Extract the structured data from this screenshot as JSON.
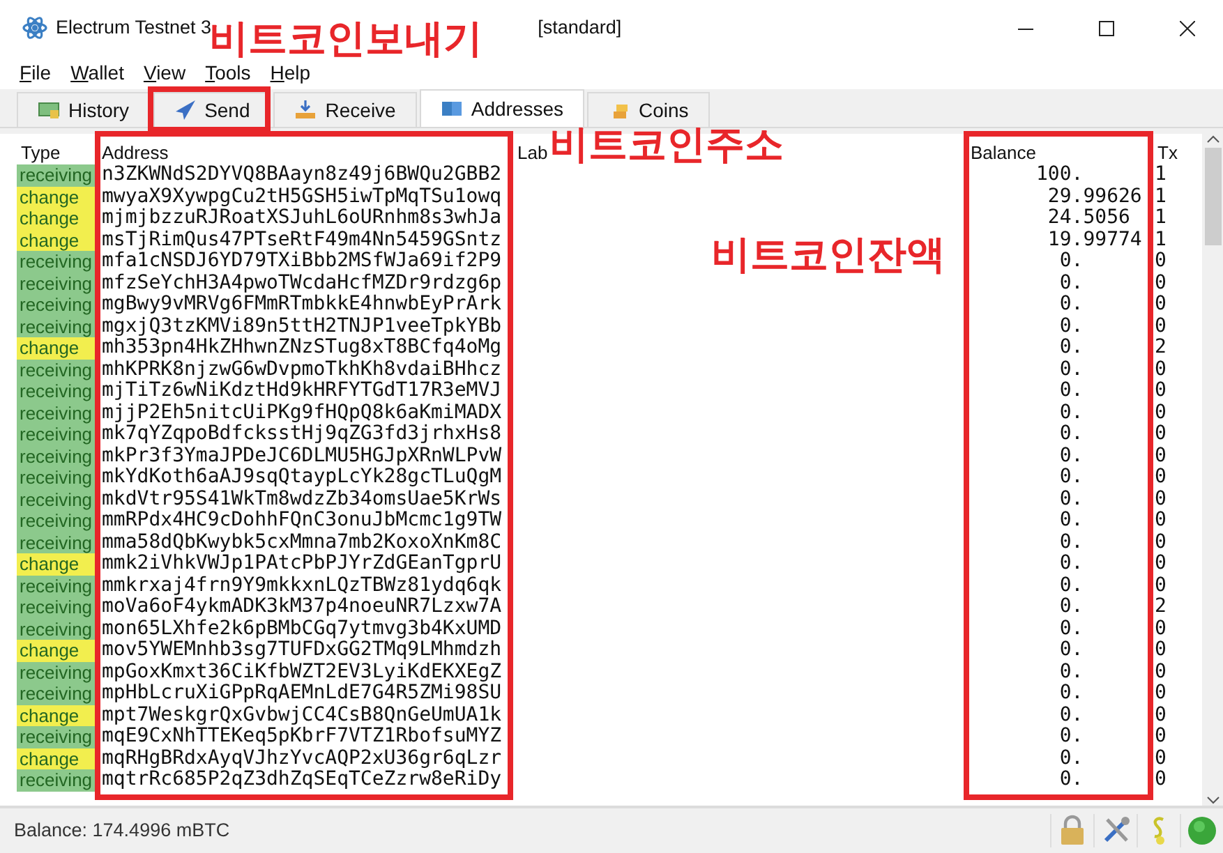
{
  "window": {
    "title": "Electrum Testnet 3",
    "title_end": "[standard]"
  },
  "menu": [
    "File",
    "Wallet",
    "View",
    "Tools",
    "Help"
  ],
  "tabs": [
    {
      "label": "History",
      "selected": false,
      "highlighted": false
    },
    {
      "label": "Send",
      "selected": false,
      "highlighted": true
    },
    {
      "label": "Receive",
      "selected": false,
      "highlighted": false
    },
    {
      "label": "Addresses",
      "selected": true,
      "highlighted": false
    },
    {
      "label": "Coins",
      "selected": false,
      "highlighted": false
    }
  ],
  "table": {
    "columns": [
      {
        "label": "Type",
        "highlighted": false
      },
      {
        "label": "Address",
        "highlighted": true
      },
      {
        "label": "Lab",
        "highlighted": false
      },
      {
        "label": "Balance",
        "highlighted": true
      },
      {
        "label": "Tx",
        "highlighted": false
      }
    ],
    "rows": [
      {
        "type": "receiving",
        "color": "#8cc98c",
        "address": "n3ZKWNdS2DYVQ8BAayn8z49j6BWQu2GBB2",
        "balance": "100.",
        "tx": "1"
      },
      {
        "type": "change",
        "color": "#f2ee4e",
        "address": "mwyaX9XywpgCu2tH5GSH5iwTpMqTSu1owq",
        "balance": "29.99626",
        "tx": "1"
      },
      {
        "type": "change",
        "color": "#f2ee4e",
        "address": "mjmjbzzuRJRoatXSJuhL6oURnhm8s3whJa",
        "balance": "24.5056",
        "tx": "1"
      },
      {
        "type": "change",
        "color": "#f2ee4e",
        "address": "msTjRimQus47PTseRtF49m4Nn5459GSntz",
        "balance": "19.99774",
        "tx": "1"
      },
      {
        "type": "receiving",
        "color": "#8cc98c",
        "address": "mfa1cNSDJ6YD79TXiBbb2MSfWJa69if2P9",
        "balance": "0.",
        "tx": "0"
      },
      {
        "type": "receiving",
        "color": "#8cc98c",
        "address": "mfzSeYchH3A4pwoTWcdaHcfMZDr9rdzg6p",
        "balance": "0.",
        "tx": "0"
      },
      {
        "type": "receiving",
        "color": "#8cc98c",
        "address": "mgBwy9vMRVg6FMmRTmbkkE4hnwbEyPrArk",
        "balance": "0.",
        "tx": "0"
      },
      {
        "type": "receiving",
        "color": "#8cc98c",
        "address": "mgxjQ3tzKMVi89n5ttH2TNJP1veeTpkYBb",
        "balance": "0.",
        "tx": "0"
      },
      {
        "type": "change",
        "color": "#f2ee4e",
        "address": "mh353pn4HkZHhwnZNzSTug8xT8BCfq4oMg",
        "balance": "0.",
        "tx": "2"
      },
      {
        "type": "receiving",
        "color": "#8cc98c",
        "address": "mhKPRK8njzwG6wDvpmoTkhKh8vdaiBHhcz",
        "balance": "0.",
        "tx": "0"
      },
      {
        "type": "receiving",
        "color": "#8cc98c",
        "address": "mjTiTz6wNiKdztHd9kHRFYTGdT17R3eMVJ",
        "balance": "0.",
        "tx": "0"
      },
      {
        "type": "receiving",
        "color": "#8cc98c",
        "address": "mjjP2Eh5nitcUiPKg9fHQpQ8k6aKmiMADX",
        "balance": "0.",
        "tx": "0"
      },
      {
        "type": "receiving",
        "color": "#8cc98c",
        "address": "mk7qYZqpoBdfcksstHj9qZG3fd3jrhxHs8",
        "balance": "0.",
        "tx": "0"
      },
      {
        "type": "receiving",
        "color": "#8cc98c",
        "address": "mkPr3f3YmaJPDeJC6DLMU5HGJpXRnWLPvW",
        "balance": "0.",
        "tx": "0"
      },
      {
        "type": "receiving",
        "color": "#8cc98c",
        "address": "mkYdKoth6aAJ9sqQtaypLcYk28gcTLuQgM",
        "balance": "0.",
        "tx": "0"
      },
      {
        "type": "receiving",
        "color": "#8cc98c",
        "address": "mkdVtr95S41WkTm8wdzZb34omsUae5KrWs",
        "balance": "0.",
        "tx": "0"
      },
      {
        "type": "receiving",
        "color": "#8cc98c",
        "address": "mmRPdx4HC9cDohhFQnC3onuJbMcmc1g9TW",
        "balance": "0.",
        "tx": "0"
      },
      {
        "type": "receiving",
        "color": "#8cc98c",
        "address": "mma58dQbKwybk5cxMmna7mb2KoxoXnKm8C",
        "balance": "0.",
        "tx": "0"
      },
      {
        "type": "change",
        "color": "#f2ee4e",
        "address": "mmk2iVhkVWJp1PAtcPbPJYrZdGEanTgprU",
        "balance": "0.",
        "tx": "0"
      },
      {
        "type": "receiving",
        "color": "#8cc98c",
        "address": "mmkrxaj4frn9Y9mkkxnLQzTBWz81ydq6qk",
        "balance": "0.",
        "tx": "0"
      },
      {
        "type": "receiving",
        "color": "#8cc98c",
        "address": "moVa6oF4ykmADK3kM37p4noeuNR7Lzxw7A",
        "balance": "0.",
        "tx": "2"
      },
      {
        "type": "receiving",
        "color": "#8cc98c",
        "address": "mon65LXhfe2k6pBMbCGq7ytmvg3b4KxUMD",
        "balance": "0.",
        "tx": "0"
      },
      {
        "type": "change",
        "color": "#f2ee4e",
        "address": "mov5YWEMnhb3sg7TUFDxGG2TMq9LMhmdzh",
        "balance": "0.",
        "tx": "0"
      },
      {
        "type": "receiving",
        "color": "#8cc98c",
        "address": "mpGoxKmxt36CiKfbWZT2EV3LyiKdEKXEgZ",
        "balance": "0.",
        "tx": "0"
      },
      {
        "type": "receiving",
        "color": "#8cc98c",
        "address": "mpHbLcruXiGPpRqAEMnLdE7G4R5ZMi98SU",
        "balance": "0.",
        "tx": "0"
      },
      {
        "type": "change",
        "color": "#f2ee4e",
        "address": "mpt7WeskgrQxGvbwjCC4CsB8QnGeUmUA1k",
        "balance": "0.",
        "tx": "0"
      },
      {
        "type": "receiving",
        "color": "#8cc98c",
        "address": "mqE9CxNhTTEKeq5pKbrF7VTZ1RbofsuMYZ",
        "balance": "0.",
        "tx": "0"
      },
      {
        "type": "change",
        "color": "#f2ee4e",
        "address": "mqRHgBRdxAyqVJhzYvcAQP2xU36gr6qLzr",
        "balance": "0.",
        "tx": "0"
      },
      {
        "type": "receiving",
        "color": "#8cc98c",
        "address": "mqtrRc685P2qZ3dhZqSEqTCeZzrw8eRiDy",
        "balance": "0.",
        "tx": "0"
      }
    ]
  },
  "status_bar": {
    "balance": "Balance: 174.4996 mBTC"
  },
  "annotations": [
    {
      "text": "비트코인보내기"
    },
    {
      "text": "비트코인주소"
    },
    {
      "text": "비트코인잔액"
    }
  ]
}
